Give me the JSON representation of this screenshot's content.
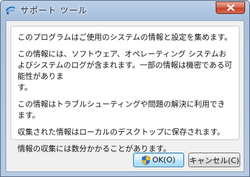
{
  "window": {
    "title": "サポート ツール",
    "icon": "app-swirl-icon",
    "close_icon": "close-x-icon"
  },
  "message": {
    "paragraphs": [
      "このプログラムはご使用のシステムの情報と設定を集めます。",
      "この情報には、ソフトウェア、オペレーティング システムおよびシステムのログが含まれます。一部の情報は機密である可能性がありま\nす。",
      "この情報はトラブルシューティングや問題の解決に利用できます。",
      "収集された情報はローカルのデスクトップに保存されます。",
      "情報の収集には数分かかることがあります。"
    ]
  },
  "buttons": {
    "ok_label": "OK(O)",
    "ok_icon": "uac-shield-icon",
    "cancel_label": "キャンセル(C)"
  }
}
